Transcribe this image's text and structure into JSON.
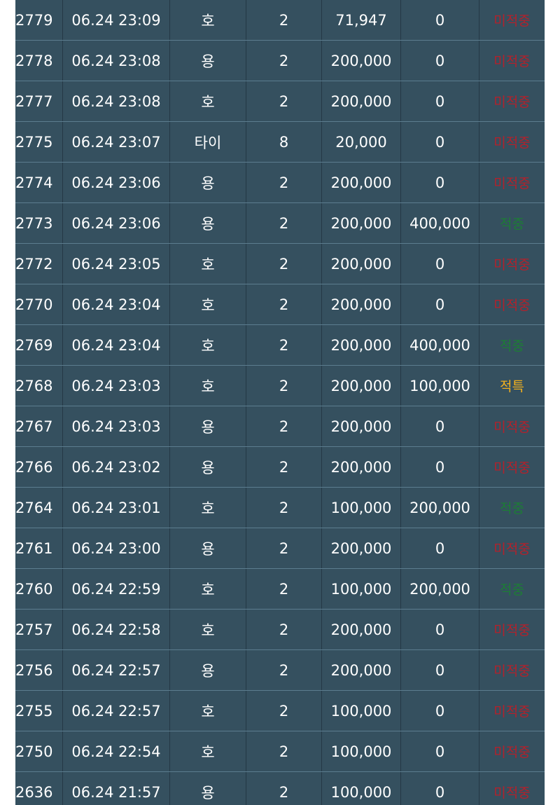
{
  "rows": [
    {
      "id": "2779",
      "datetime": "06.24 23:09",
      "pick": "호",
      "multiplier": "2",
      "bet": "71,947",
      "payout": "0",
      "result": "미적중",
      "result_type": "lose"
    },
    {
      "id": "2778",
      "datetime": "06.24 23:08",
      "pick": "용",
      "multiplier": "2",
      "bet": "200,000",
      "payout": "0",
      "result": "미적중",
      "result_type": "lose"
    },
    {
      "id": "2777",
      "datetime": "06.24 23:08",
      "pick": "호",
      "multiplier": "2",
      "bet": "200,000",
      "payout": "0",
      "result": "미적중",
      "result_type": "lose"
    },
    {
      "id": "2775",
      "datetime": "06.24 23:07",
      "pick": "타이",
      "multiplier": "8",
      "bet": "20,000",
      "payout": "0",
      "result": "미적중",
      "result_type": "lose"
    },
    {
      "id": "2774",
      "datetime": "06.24 23:06",
      "pick": "용",
      "multiplier": "2",
      "bet": "200,000",
      "payout": "0",
      "result": "미적중",
      "result_type": "lose"
    },
    {
      "id": "2773",
      "datetime": "06.24 23:06",
      "pick": "용",
      "multiplier": "2",
      "bet": "200,000",
      "payout": "400,000",
      "result": "적중",
      "result_type": "win"
    },
    {
      "id": "2772",
      "datetime": "06.24 23:05",
      "pick": "호",
      "multiplier": "2",
      "bet": "200,000",
      "payout": "0",
      "result": "미적중",
      "result_type": "lose"
    },
    {
      "id": "2770",
      "datetime": "06.24 23:04",
      "pick": "호",
      "multiplier": "2",
      "bet": "200,000",
      "payout": "0",
      "result": "미적중",
      "result_type": "lose"
    },
    {
      "id": "2769",
      "datetime": "06.24 23:04",
      "pick": "호",
      "multiplier": "2",
      "bet": "200,000",
      "payout": "400,000",
      "result": "적중",
      "result_type": "win"
    },
    {
      "id": "2768",
      "datetime": "06.24 23:03",
      "pick": "호",
      "multiplier": "2",
      "bet": "200,000",
      "payout": "100,000",
      "result": "적특",
      "result_type": "special"
    },
    {
      "id": "2767",
      "datetime": "06.24 23:03",
      "pick": "용",
      "multiplier": "2",
      "bet": "200,000",
      "payout": "0",
      "result": "미적중",
      "result_type": "lose"
    },
    {
      "id": "2766",
      "datetime": "06.24 23:02",
      "pick": "용",
      "multiplier": "2",
      "bet": "200,000",
      "payout": "0",
      "result": "미적중",
      "result_type": "lose"
    },
    {
      "id": "2764",
      "datetime": "06.24 23:01",
      "pick": "호",
      "multiplier": "2",
      "bet": "100,000",
      "payout": "200,000",
      "result": "적중",
      "result_type": "win"
    },
    {
      "id": "2761",
      "datetime": "06.24 23:00",
      "pick": "용",
      "multiplier": "2",
      "bet": "200,000",
      "payout": "0",
      "result": "미적중",
      "result_type": "lose"
    },
    {
      "id": "2760",
      "datetime": "06.24 22:59",
      "pick": "호",
      "multiplier": "2",
      "bet": "100,000",
      "payout": "200,000",
      "result": "적중",
      "result_type": "win"
    },
    {
      "id": "2757",
      "datetime": "06.24 22:58",
      "pick": "호",
      "multiplier": "2",
      "bet": "200,000",
      "payout": "0",
      "result": "미적중",
      "result_type": "lose"
    },
    {
      "id": "2756",
      "datetime": "06.24 22:57",
      "pick": "용",
      "multiplier": "2",
      "bet": "200,000",
      "payout": "0",
      "result": "미적중",
      "result_type": "lose"
    },
    {
      "id": "2755",
      "datetime": "06.24 22:57",
      "pick": "호",
      "multiplier": "2",
      "bet": "100,000",
      "payout": "0",
      "result": "미적중",
      "result_type": "lose"
    },
    {
      "id": "2750",
      "datetime": "06.24 22:54",
      "pick": "호",
      "multiplier": "2",
      "bet": "100,000",
      "payout": "0",
      "result": "미적중",
      "result_type": "lose"
    },
    {
      "id": "2636",
      "datetime": "06.24 21:57",
      "pick": "용",
      "multiplier": "2",
      "bet": "100,000",
      "payout": "0",
      "result": "미적중",
      "result_type": "lose"
    }
  ],
  "colors": {
    "table_bg": "#35505f",
    "row_border": "#5c7d8f",
    "result_lose": "#b3212b",
    "result_win": "#1d7d35",
    "result_special": "#f2b01e"
  }
}
